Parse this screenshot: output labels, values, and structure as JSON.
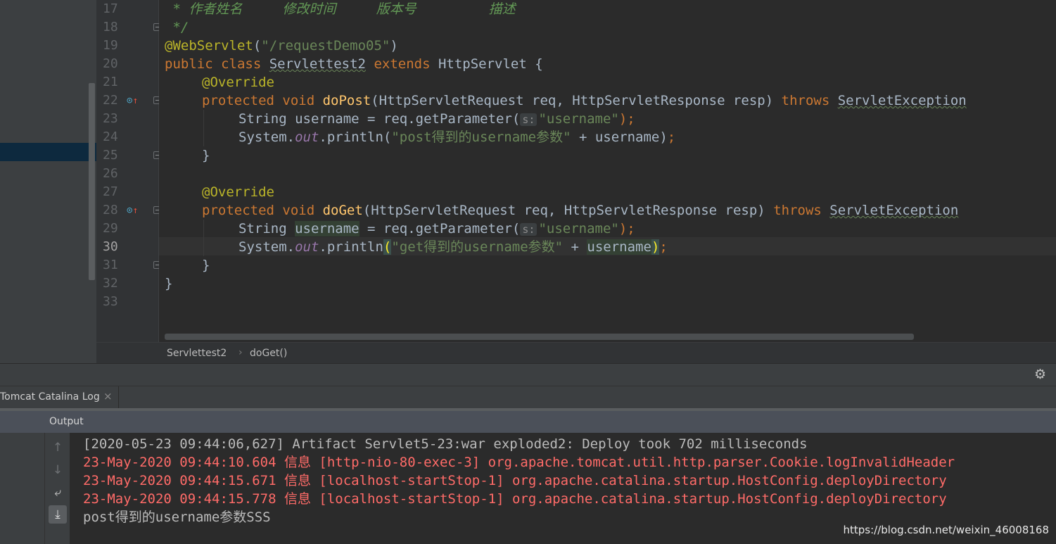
{
  "editor": {
    "line_numbers": [
      "17",
      "18",
      "19",
      "20",
      "21",
      "22",
      "23",
      "24",
      "25",
      "26",
      "27",
      "28",
      "29",
      "30",
      "31",
      "32",
      "33"
    ],
    "current_line": "30",
    "lines": {
      "l17": " * 作者姓名     修改时间     版本号         描述",
      "l18": " */",
      "l19_ann": "@WebServlet",
      "l19_open": "(",
      "l19_str": "\"/requestDemo05\"",
      "l19_close": ")",
      "l20_kw": "public class ",
      "l20_cls": "Servlettest2",
      "l20_ext": " extends ",
      "l20_base": "HttpServlet {",
      "l21": "@Override",
      "l22_kw": "protected void ",
      "l22_fn": "doPost",
      "l22_params": "(HttpServletRequest req, HttpServletResponse resp) ",
      "l22_throws": "throws ",
      "l22_exc": "ServletException",
      "l23_code": "String username = req.getParameter(",
      "hint": "s:",
      "l23_str": "\"username\"",
      "l23_end": ");",
      "l24_a": "System.",
      "l24_out": "out",
      "l24_b": ".println(",
      "l24_str": "\"post得到的username参数\"",
      "l24_c": " + username)",
      "l24_semi": ";",
      "l25": "}",
      "l27": "@Override",
      "l28_kw": "protected void ",
      "l28_fn": "doGet",
      "l28_params": "(HttpServletRequest req, HttpServletResponse resp) ",
      "l28_throws": "throws ",
      "l28_exc": "ServletException",
      "l29_a": "String ",
      "l29_var": "username",
      "l29_b": " = req.getParameter(",
      "l29_str": "\"username\"",
      "l29_end": ");",
      "l30_a": "System.",
      "l30_out": "out",
      "l30_b": ".println",
      "l30_open": "(",
      "l30_str": "\"get得到的username参数\"",
      "l30_c": " + ",
      "l30_var": "username",
      "l30_close": ")",
      "l30_semi": ";",
      "l31": "}",
      "l32": "}"
    }
  },
  "breadcrumb": {
    "class": "Servlettest2",
    "method": "doGet()"
  },
  "tool_window": {
    "tab_label": "Tomcat Catalina Log",
    "tab_close": "×",
    "output_label": "Output",
    "settings_icon": "gear-icon"
  },
  "console": {
    "lines": [
      "[2020-05-23 09:44:06,627] Artifact Servlet5-23:war exploded2: Deploy took 702 milliseconds",
      "23-May-2020 09:44:10.604 信息 [http-nio-80-exec-3] org.apache.tomcat.util.http.parser.Cookie.logInvalidHeader",
      "23-May-2020 09:44:15.671 信息 [localhost-startStop-1] org.apache.catalina.startup.HostConfig.deployDirectory",
      "23-May-2020 09:44:15.778 信息 [localhost-startStop-1] org.apache.catalina.startup.HostConfig.deployDirectory",
      "post得到的username参数SSS"
    ],
    "line_colors": [
      "#bbbbbb",
      "#ff6b68",
      "#ff6b68",
      "#ff6b68",
      "#bbbbbb"
    ]
  },
  "watermark": "https://blog.csdn.net/weixin_46008168"
}
